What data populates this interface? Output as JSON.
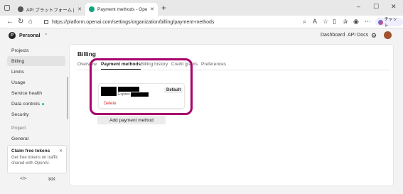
{
  "browser": {
    "tabs": [
      {
        "title": "API プラットフォーム | OpenAI",
        "active": false
      },
      {
        "title": "Payment methods - OpenAI API",
        "active": true
      }
    ],
    "new_tab": "+",
    "window_controls": {
      "minimize": "–",
      "maximize": "☐",
      "close": "✕"
    },
    "url": "https://platform.openai.com/settings/organization/billing/payment-methods",
    "chat_button": "チャット"
  },
  "header": {
    "org_initial": "P",
    "org_name": "Personal",
    "links": {
      "dashboard": "Dashboard",
      "api_docs": "API Docs"
    }
  },
  "sidebar": {
    "items": [
      {
        "label": "Projects"
      },
      {
        "label": "Billing",
        "active": true
      },
      {
        "label": "Limits"
      },
      {
        "label": "Usage"
      },
      {
        "label": "Service health"
      },
      {
        "label": "Data controls",
        "status_dot": true
      },
      {
        "label": "Security"
      }
    ],
    "section_project": "Project",
    "section_general": "General",
    "promo": {
      "title": "Claim free tokens",
      "text": "Get free tokens on traffic shared with OpenAI."
    },
    "footer": {
      "left": "</>",
      "right": "ℵℵ"
    }
  },
  "main": {
    "title": "Billing",
    "tabs": [
      {
        "label": "Overview",
        "active": false
      },
      {
        "label": "Payment methods",
        "active": true
      },
      {
        "label": "Billing history",
        "active": false
      },
      {
        "label": "Credit grants",
        "active": false
      },
      {
        "label": "Preferences",
        "active": false
      }
    ],
    "card": {
      "expires_label": "Expires",
      "badge": "Default",
      "delete_label": "Delete"
    },
    "add_button": "Add payment method"
  },
  "colors": {
    "highlight": "#a8006b",
    "delete": "#d12b2b",
    "status_dot": "#19c37d"
  }
}
